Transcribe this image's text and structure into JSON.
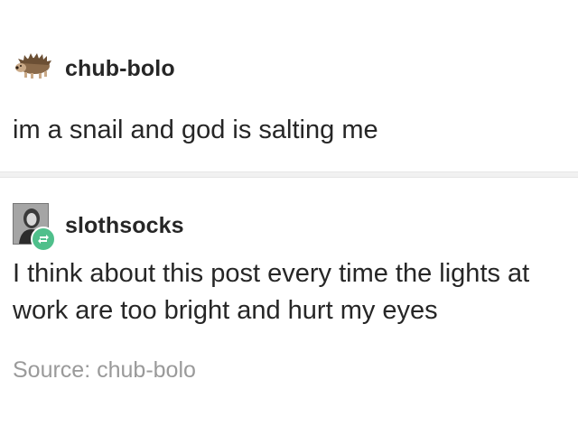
{
  "posts": [
    {
      "username": "chub-bolo",
      "avatar_icon": "hedgehog-icon",
      "text": "im a snail and god is salting me"
    },
    {
      "username": "slothsocks",
      "avatar_icon": "profile-photo",
      "badge_icon": "reblog-icon",
      "badge_color": "#4fbf8b",
      "text": "I think about this post every time the lights at work are too bright and hurt my eyes",
      "source": "Source: chub-bolo"
    }
  ]
}
